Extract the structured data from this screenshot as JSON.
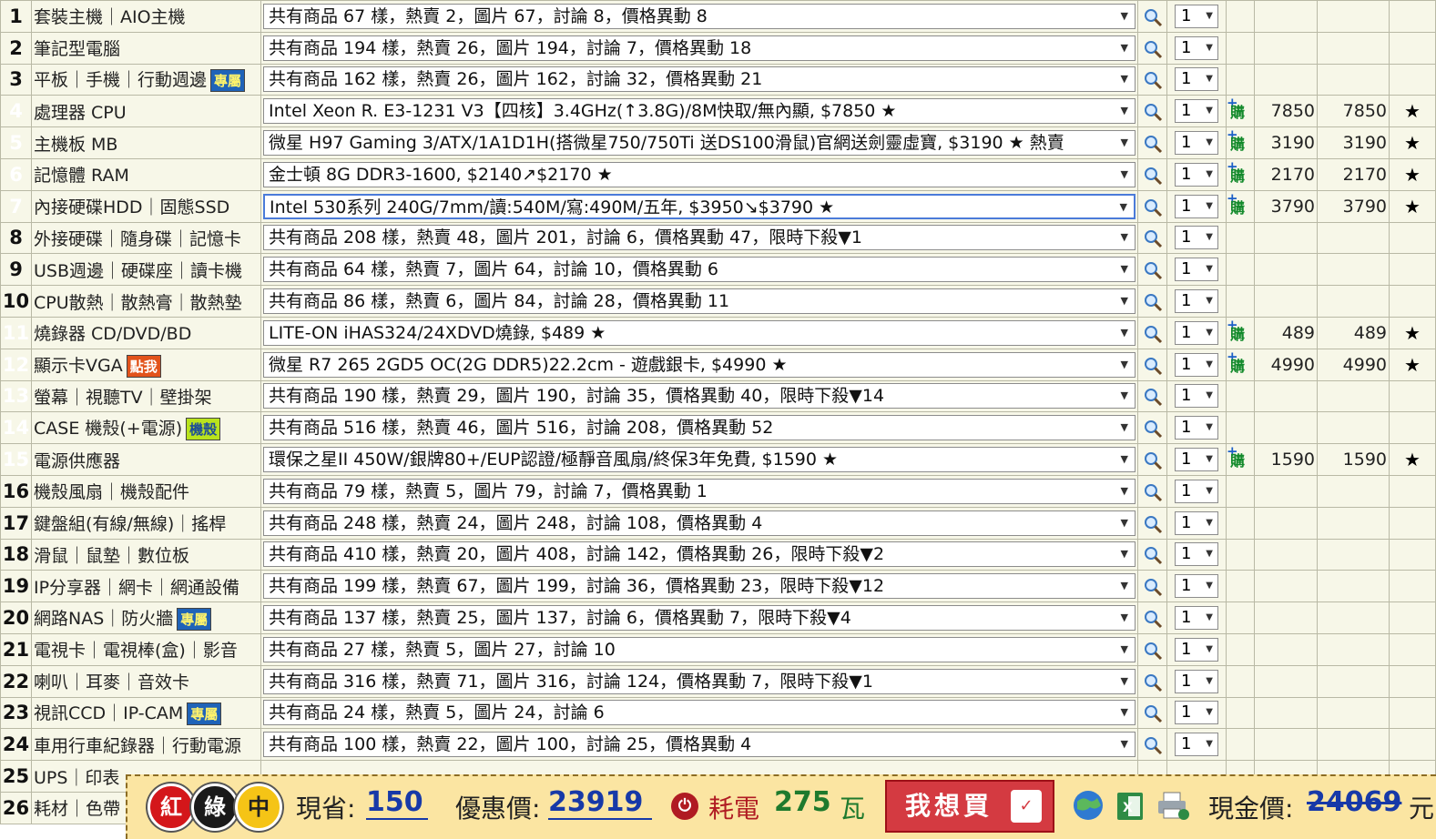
{
  "rows": [
    {
      "n": "1",
      "color": "white",
      "cat": "套裝主機｜AIO主機",
      "badge": null,
      "sel": "共有商品 67 樣，熱賣 2，圖片 67，討論 8，價格異動 8",
      "qty": "1",
      "buy": false,
      "p1": "",
      "p2": "",
      "star": ""
    },
    {
      "n": "2",
      "color": "white",
      "cat": "筆記型電腦",
      "badge": null,
      "sel": "共有商品 194 樣，熱賣 26，圖片 194，討論 7，價格異動 18",
      "qty": "1",
      "buy": false,
      "p1": "",
      "p2": "",
      "star": ""
    },
    {
      "n": "3",
      "color": "white",
      "cat": "平板｜手機｜行動週邊",
      "badge": {
        "text": "專屬",
        "style": "blue"
      },
      "sel": "共有商品 162 樣，熱賣 26，圖片 162，討論 32，價格異動 21",
      "qty": "1",
      "buy": false,
      "p1": "",
      "p2": "",
      "star": ""
    },
    {
      "n": "4",
      "color": "red",
      "cat": "處理器 CPU",
      "badge": null,
      "sel": "Intel Xeon R. E3-1231 V3【四核】3.4GHz(↑3.8G)/8M快取/無內顯, $7850 ★",
      "qty": "1",
      "buy": true,
      "p1": "7850",
      "p2": "7850",
      "star": "★"
    },
    {
      "n": "5",
      "color": "green",
      "cat": "主機板 MB",
      "badge": null,
      "sel": "微星 H97 Gaming 3/ATX/1A1D1H(搭微星750/750Ti 送DS100滑鼠)官網送劍靈虛寶, $3190 ★ 熱賣",
      "qty": "1",
      "buy": true,
      "p1": "3190",
      "p2": "3190",
      "star": "★"
    },
    {
      "n": "6",
      "color": "red",
      "cat": "記憶體 RAM",
      "badge": null,
      "sel": "金士頓 8G DDR3-1600, $2140↗$2170 ★",
      "qty": "1",
      "buy": true,
      "p1": "2170",
      "p2": "2170",
      "star": "★"
    },
    {
      "n": "7",
      "color": "red",
      "cat": "內接硬碟HDD｜固態SSD",
      "badge": null,
      "sel": "Intel 530系列 240G/7mm/讀:540M/寫:490M/五年, $3950↘$3790 ★",
      "qty": "1",
      "buy": true,
      "p1": "3790",
      "p2": "3790",
      "star": "★",
      "focus": true
    },
    {
      "n": "8",
      "color": "white",
      "cat": "外接硬碟｜隨身碟｜記憶卡",
      "badge": null,
      "sel": "共有商品 208 樣，熱賣 48，圖片 201，討論 6，價格異動 47，限時下殺▼1",
      "qty": "1",
      "buy": false,
      "p1": "",
      "p2": "",
      "star": ""
    },
    {
      "n": "9",
      "color": "white",
      "cat": "USB週邊｜硬碟座｜讀卡機",
      "badge": null,
      "sel": "共有商品 64 樣，熱賣 7，圖片 64，討論 10，價格異動 6",
      "qty": "1",
      "buy": false,
      "p1": "",
      "p2": "",
      "star": ""
    },
    {
      "n": "10",
      "color": "white",
      "cat": "CPU散熱｜散熱膏｜散熱墊",
      "badge": null,
      "sel": "共有商品 86 樣，熱賣 6，圖片 84，討論 28，價格異動 11",
      "qty": "1",
      "buy": false,
      "p1": "",
      "p2": "",
      "star": ""
    },
    {
      "n": "11",
      "color": "green",
      "cat": "燒錄器 CD/DVD/BD",
      "badge": null,
      "sel": "LITE-ON iHAS324/24XDVD燒錄, $489 ★",
      "qty": "1",
      "buy": true,
      "p1": "489",
      "p2": "489",
      "star": "★"
    },
    {
      "n": "12",
      "color": "green",
      "cat": "顯示卡VGA",
      "badge": {
        "text": "點我",
        "style": "orange"
      },
      "sel": "微星 R7 265 2GD5 OC(2G DDR5)22.2cm - 遊戲銀卡, $4990 ★",
      "qty": "1",
      "buy": true,
      "p1": "4990",
      "p2": "4990",
      "star": "★"
    },
    {
      "n": "13",
      "color": "green",
      "cat": "螢幕｜視聽TV｜壁掛架",
      "badge": null,
      "sel": "共有商品 190 樣，熱賣 29，圖片 190，討論 35，價格異動 40，限時下殺▼14",
      "qty": "1",
      "buy": false,
      "p1": "",
      "p2": "",
      "star": ""
    },
    {
      "n": "14",
      "color": "green",
      "cat": "CASE 機殼(+電源)",
      "badge": {
        "text": "機殼",
        "style": "lime"
      },
      "sel": "共有商品 516 樣，熱賣 46，圖片 516，討論 208，價格異動 52",
      "qty": "1",
      "buy": false,
      "p1": "",
      "p2": "",
      "star": ""
    },
    {
      "n": "15",
      "color": "red",
      "cat": "電源供應器",
      "badge": null,
      "sel": "環保之星II 450W/銀牌80+/EUP認證/極靜音風扇/終保3年免費, $1590 ★",
      "qty": "1",
      "buy": true,
      "p1": "1590",
      "p2": "1590",
      "star": "★"
    },
    {
      "n": "16",
      "color": "white",
      "cat": "機殼風扇｜機殼配件",
      "badge": null,
      "sel": "共有商品 79 樣，熱賣 5，圖片 79，討論 7，價格異動 1",
      "qty": "1",
      "buy": false,
      "p1": "",
      "p2": "",
      "star": ""
    },
    {
      "n": "17",
      "color": "white",
      "cat": "鍵盤組(有線/無線)｜搖桿",
      "badge": null,
      "sel": "共有商品 248 樣，熱賣 24，圖片 248，討論 108，價格異動 4",
      "qty": "1",
      "buy": false,
      "p1": "",
      "p2": "",
      "star": ""
    },
    {
      "n": "18",
      "color": "white",
      "cat": "滑鼠｜鼠墊｜數位板",
      "badge": null,
      "sel": "共有商品 410 樣，熱賣 20，圖片 408，討論 142，價格異動 26，限時下殺▼2",
      "qty": "1",
      "buy": false,
      "p1": "",
      "p2": "",
      "star": ""
    },
    {
      "n": "19",
      "color": "white",
      "cat": "IP分享器｜網卡｜網通設備",
      "badge": null,
      "sel": "共有商品 199 樣，熱賣 67，圖片 199，討論 36，價格異動 23，限時下殺▼12",
      "qty": "1",
      "buy": false,
      "p1": "",
      "p2": "",
      "star": ""
    },
    {
      "n": "20",
      "color": "white",
      "cat": "網路NAS｜防火牆",
      "badge": {
        "text": "專屬",
        "style": "blue"
      },
      "sel": "共有商品 137 樣，熱賣 25，圖片 137，討論 6，價格異動 7，限時下殺▼4",
      "qty": "1",
      "buy": false,
      "p1": "",
      "p2": "",
      "star": ""
    },
    {
      "n": "21",
      "color": "white",
      "cat": "電視卡｜電視棒(盒)｜影音",
      "badge": null,
      "sel": "共有商品 27 樣，熱賣 5，圖片 27，討論 10",
      "qty": "1",
      "buy": false,
      "p1": "",
      "p2": "",
      "star": ""
    },
    {
      "n": "22",
      "color": "white",
      "cat": "喇叭｜耳麥｜音效卡",
      "badge": null,
      "sel": "共有商品 316 樣，熱賣 71，圖片 316，討論 124，價格異動 7，限時下殺▼1",
      "qty": "1",
      "buy": false,
      "p1": "",
      "p2": "",
      "star": ""
    },
    {
      "n": "23",
      "color": "white",
      "cat": "視訊CCD｜IP-CAM",
      "badge": {
        "text": "專屬",
        "style": "blue"
      },
      "sel": "共有商品 24 樣，熱賣 5，圖片 24，討論 6",
      "qty": "1",
      "buy": false,
      "p1": "",
      "p2": "",
      "star": ""
    },
    {
      "n": "24",
      "color": "white",
      "cat": "車用行車紀錄器｜行動電源",
      "badge": null,
      "sel": "共有商品 100 樣，熱賣 22，圖片 100，討論 25，價格異動 4",
      "qty": "1",
      "buy": false,
      "p1": "",
      "p2": "",
      "star": ""
    },
    {
      "n": "25",
      "color": "white",
      "cat": "UPS｜印表",
      "badge": null,
      "sel": "",
      "qty": "",
      "buy": false,
      "p1": "",
      "p2": "",
      "star": ""
    },
    {
      "n": "26",
      "color": "white",
      "cat": "耗材｜色帶",
      "badge": null,
      "sel": "",
      "qty": "",
      "buy": false,
      "p1": "",
      "p2": "",
      "star": ""
    }
  ],
  "buy_label": "購",
  "bar": {
    "circles": [
      "紅",
      "綠",
      "中"
    ],
    "save_label": "現省:",
    "save_value": "150",
    "discount_label": "優惠價:",
    "discount_value": "23919",
    "power_label": "耗電",
    "power_value": "275",
    "power_unit": "瓦",
    "want_label": "我想買",
    "cash_label": "現金價:",
    "cash_value": "24069",
    "cash_unit": "元"
  }
}
